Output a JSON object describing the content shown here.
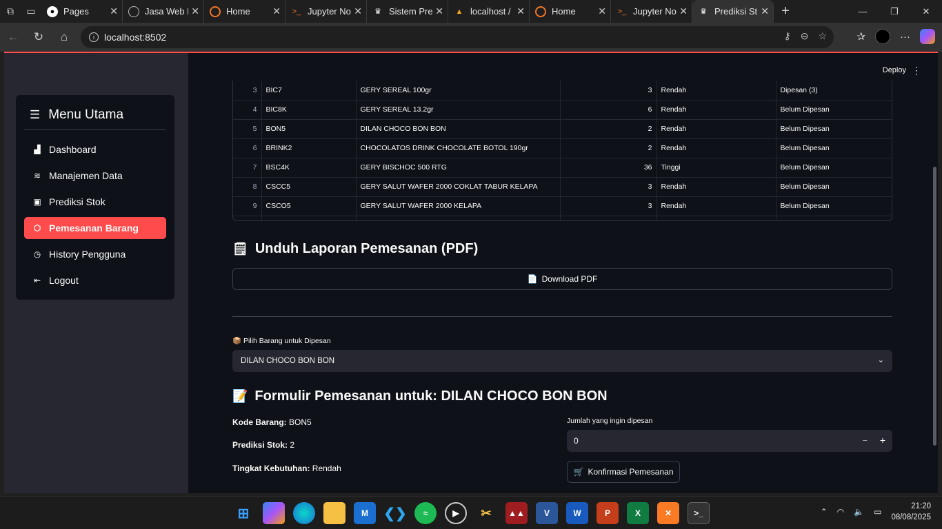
{
  "browser": {
    "tabs": [
      {
        "title": "Pages",
        "icon": "github-icon"
      },
      {
        "title": "Jasa Web D",
        "icon": "globe-icon"
      },
      {
        "title": "Home",
        "icon": "jupyter-icon"
      },
      {
        "title": "Jupyter No",
        "icon": "terminal-icon"
      },
      {
        "title": "Sistem Pre",
        "icon": "streamlit-icon"
      },
      {
        "title": "localhost /",
        "icon": "phpmyadmin-icon"
      },
      {
        "title": "Home",
        "icon": "jupyter-icon"
      },
      {
        "title": "Jupyter No",
        "icon": "terminal-icon"
      },
      {
        "title": "Prediksi St",
        "icon": "streamlit-icon"
      }
    ],
    "url": "localhost:8502"
  },
  "sidebar": {
    "title": "Menu Utama",
    "items": [
      {
        "label": "Dashboard",
        "icon": "bar-chart-icon"
      },
      {
        "label": "Manajemen Data",
        "icon": "database-icon"
      },
      {
        "label": "Prediksi Stok",
        "icon": "clipboard-chart-icon"
      },
      {
        "label": "Pemesanan Barang",
        "icon": "box-icon",
        "active": true
      },
      {
        "label": "History Pengguna",
        "icon": "clock-icon"
      },
      {
        "label": "Logout",
        "icon": "logout-icon"
      }
    ]
  },
  "header": {
    "deploy_label": "Deploy"
  },
  "table": {
    "rows": [
      {
        "idx": "3",
        "kode": "BIC7",
        "nama": "GERY SEREAL 100gr",
        "pred": "3",
        "tingkat": "Rendah",
        "status": "Dipesan (3)"
      },
      {
        "idx": "4",
        "kode": "BIC8K",
        "nama": "GERY SEREAL 13.2gr",
        "pred": "6",
        "tingkat": "Rendah",
        "status": "Belum Dipesan"
      },
      {
        "idx": "5",
        "kode": "BON5",
        "nama": "DILAN CHOCO BON BON",
        "pred": "2",
        "tingkat": "Rendah",
        "status": "Belum Dipesan"
      },
      {
        "idx": "6",
        "kode": "BRINK2",
        "nama": "CHOCOLATOS DRINK CHOCOLATE BOTOL 190gr",
        "pred": "2",
        "tingkat": "Rendah",
        "status": "Belum Dipesan"
      },
      {
        "idx": "7",
        "kode": "BSC4K",
        "nama": "GERY BISCHOC 500 RTG",
        "pred": "36",
        "tingkat": "Tinggi",
        "status": "Belum Dipesan"
      },
      {
        "idx": "8",
        "kode": "CSCC5",
        "nama": "GERY SALUT WAFER 2000 COKLAT TABUR KELAPA",
        "pred": "3",
        "tingkat": "Rendah",
        "status": "Belum Dipesan"
      },
      {
        "idx": "9",
        "kode": "CSCO5",
        "nama": "GERY SALUT WAFER 2000 KELAPA",
        "pred": "3",
        "tingkat": "Rendah",
        "status": "Belum Dipesan"
      }
    ]
  },
  "report": {
    "heading": "Unduh Laporan Pemesanan (PDF)",
    "download_label": "Download PDF"
  },
  "order": {
    "select_label": "Pilih Barang untuk Dipesan",
    "selected": "DILAN CHOCO BON BON",
    "form_heading": "Formulir Pemesanan untuk: DILAN CHOCO BON BON",
    "kode_label": "Kode Barang:",
    "kode_value": "BON5",
    "prediksi_label": "Prediksi Stok:",
    "prediksi_value": "2",
    "tingkat_label": "Tingkat Kebutuhan:",
    "tingkat_value": "Rendah",
    "qty_label": "Jumlah yang ingin dipesan",
    "qty_value": "0",
    "confirm_label": "Konfirmasi Pemesanan"
  },
  "taskbar": {
    "time": "21:20",
    "date": "08/08/2025"
  },
  "colors": {
    "accent": "#ff4b4b",
    "app_bg": "#0e1117",
    "sidebar_bg": "#262730"
  }
}
